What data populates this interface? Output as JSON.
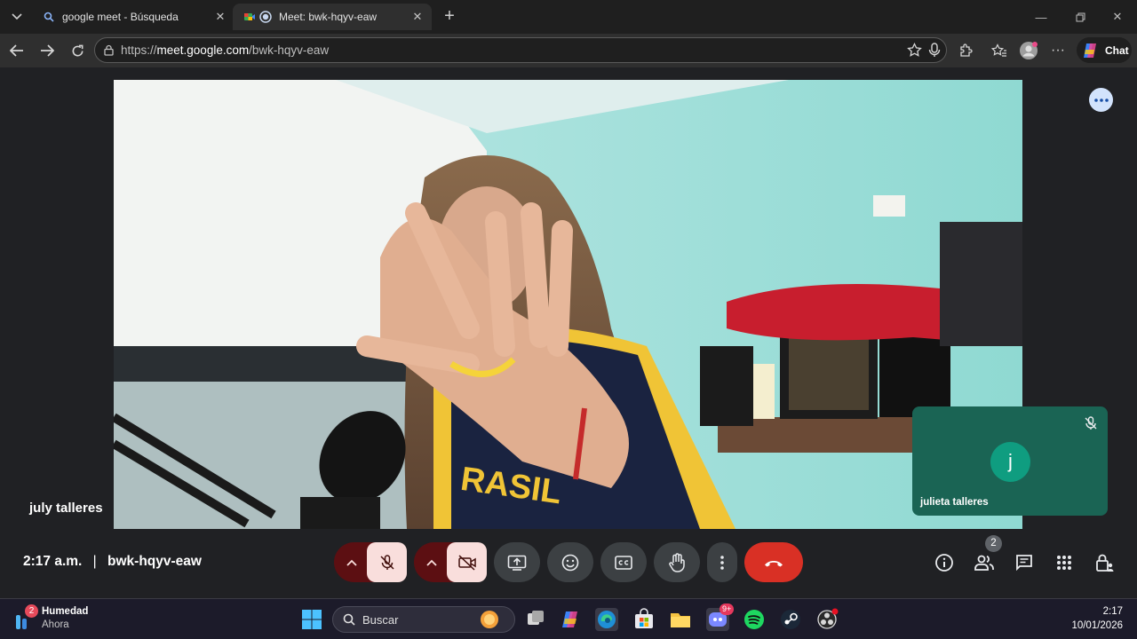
{
  "browser": {
    "tabs": [
      {
        "title": "google meet - Búsqueda",
        "icon": "search-icon",
        "active": false
      },
      {
        "title": "Meet: bwk-hqyv-eaw",
        "icon": "meet-icon",
        "active": true
      }
    ],
    "url_prefix": "https://",
    "url_host": "meet.google.com",
    "url_path": "/bwk-hqyv-eaw",
    "chat_label": "Chat"
  },
  "meet": {
    "main_participant": "july talleres",
    "self_participant": "julieta talleres",
    "self_avatar_letter": "j",
    "time": "2:17 a.m.",
    "separator": "|",
    "meeting_code": "bwk-hqyv-eaw",
    "people_count": "2",
    "colors": {
      "end_call": "#d93025",
      "muted": "#f9dedc",
      "muted_chevron": "#5c0f12",
      "self_tile": "#1a6454"
    }
  },
  "taskbar": {
    "weather_badge": "2",
    "weather_title": "Humedad",
    "weather_sub": "Ahora",
    "search_placeholder": "Buscar",
    "discord_badge": "9+",
    "time": "2:17",
    "date": "10/01/2026"
  }
}
